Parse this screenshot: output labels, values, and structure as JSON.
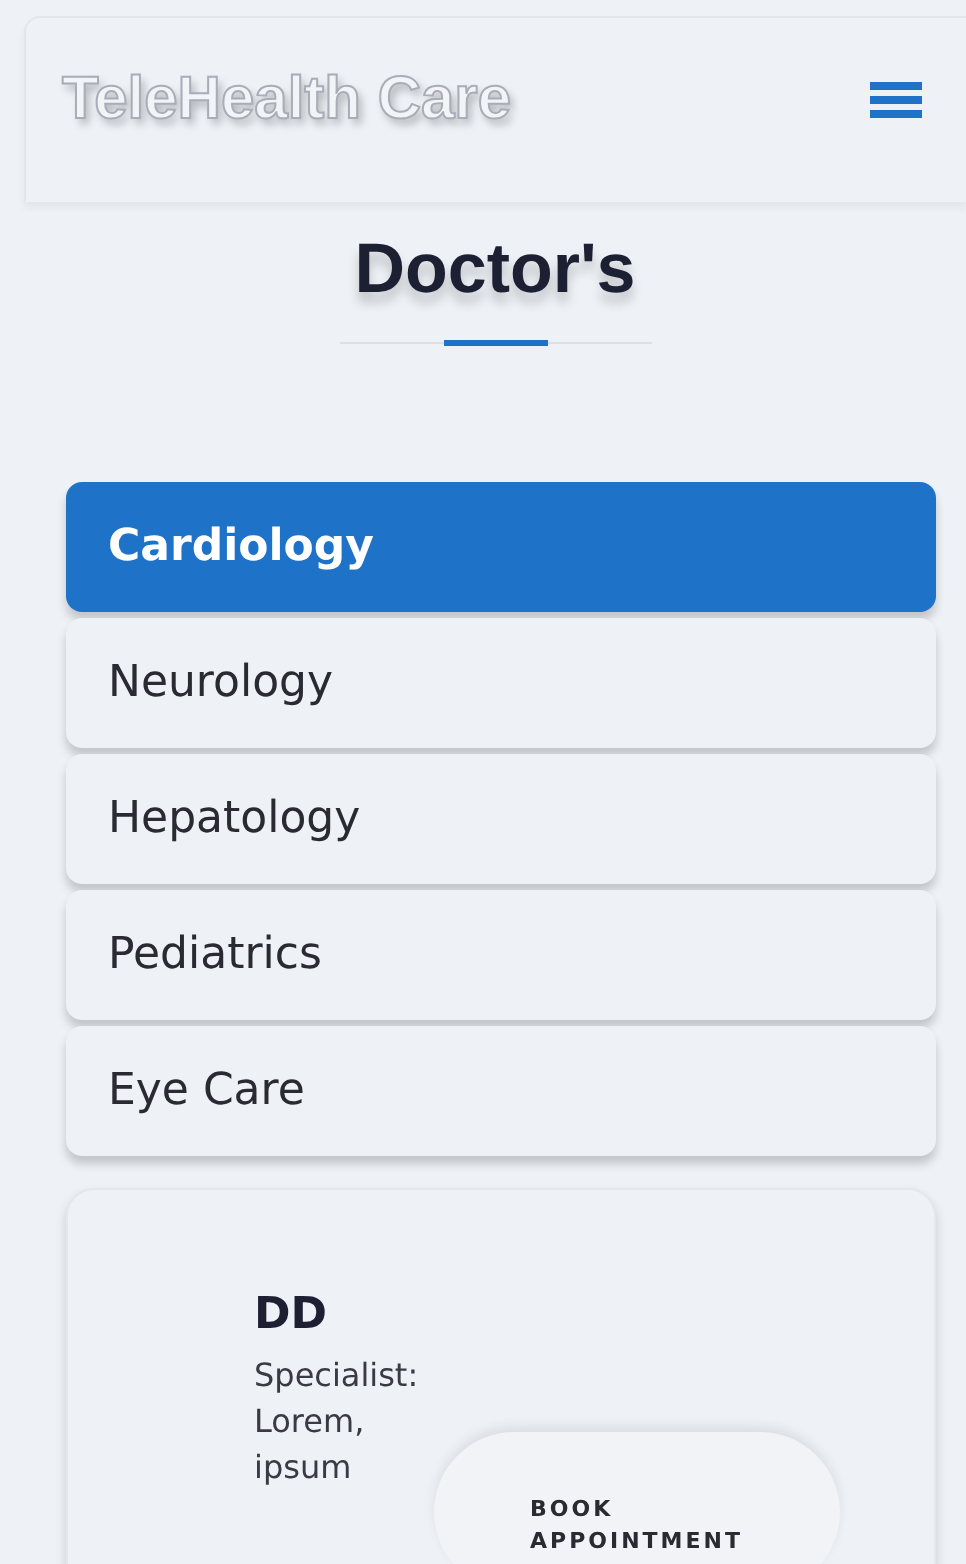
{
  "header": {
    "brand": "TeleHealth Care"
  },
  "section": {
    "title": "Doctor's"
  },
  "tabs": [
    {
      "label": "Cardiology",
      "selected": true
    },
    {
      "label": "Neurology",
      "selected": false
    },
    {
      "label": "Hepatology",
      "selected": false
    },
    {
      "label": "Pediatrics",
      "selected": false
    },
    {
      "label": "Eye Care",
      "selected": false
    }
  ],
  "doctor_card": {
    "name": "DD",
    "description": "Specialist: Lorem, ipsum",
    "button": "BOOK APPOINTMENT"
  }
}
